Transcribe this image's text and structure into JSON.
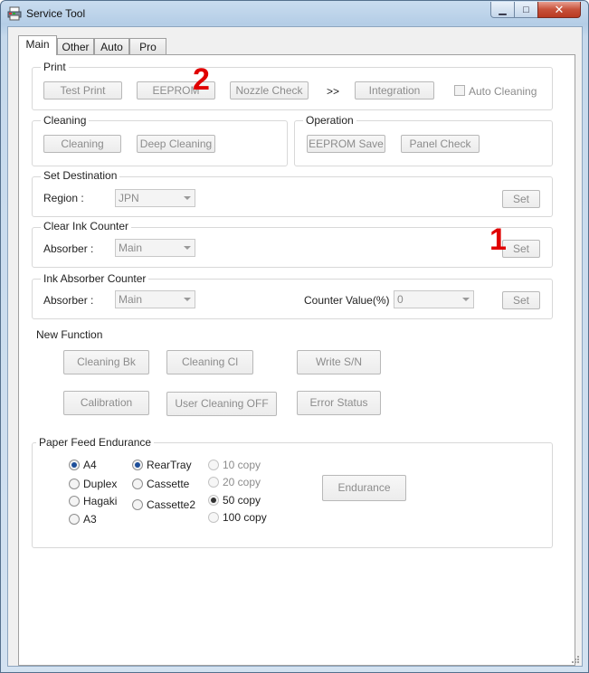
{
  "window": {
    "title": "Service Tool",
    "icon": "printer-app-icon"
  },
  "tabs": [
    {
      "label": "Main",
      "active": true
    },
    {
      "label": "Other",
      "active": false
    },
    {
      "label": "Auto",
      "active": false
    },
    {
      "label": "Pro",
      "active": false
    }
  ],
  "print": {
    "label": "Print",
    "test_print": "Test Print",
    "eeprom": "EEPROM",
    "nozzle_check": "Nozzle Check",
    "arrows": ">>",
    "integration": "Integration",
    "auto_cleaning": "Auto Cleaning"
  },
  "cleaning": {
    "label": "Cleaning",
    "cleaning": "Cleaning",
    "deep_cleaning": "Deep Cleaning"
  },
  "operation": {
    "label": "Operation",
    "eeprom_save": "EEPROM Save",
    "panel_check": "Panel Check"
  },
  "set_destination": {
    "label": "Set Destination",
    "region_label": "Region :",
    "region_value": "JPN",
    "set": "Set"
  },
  "clear_ink_counter": {
    "label": "Clear Ink Counter",
    "absorber_label": "Absorber :",
    "absorber_value": "Main",
    "set": "Set"
  },
  "ink_absorber_counter": {
    "label": "Ink Absorber Counter",
    "absorber_label": "Absorber :",
    "absorber_value": "Main",
    "counter_label": "Counter Value(%) :",
    "counter_value": "0",
    "set": "Set"
  },
  "new_function": {
    "label": "New Function",
    "cleaning_bk": "Cleaning Bk",
    "cleaning_cl": "Cleaning Cl",
    "write_sn": "Write S/N",
    "calibration": "Calibration",
    "user_cleaning_off": "User Cleaning OFF",
    "error_status": "Error Status"
  },
  "paper_feed": {
    "label": "Paper Feed Endurance",
    "sizes": [
      "A4",
      "Duplex",
      "Hagaki",
      "A3"
    ],
    "sources": [
      "RearTray",
      "Cassette",
      "Cassette2"
    ],
    "copies": [
      "10 copy",
      "20 copy",
      "50 copy",
      "100 copy"
    ],
    "selected_size": "A4",
    "selected_source": "RearTray",
    "selected_copies": "50 copy",
    "endurance": "Endurance"
  },
  "annotations": {
    "one": "1",
    "two": "2"
  },
  "colors": {
    "annotation": "#e00000",
    "radio_selected": "#1e4f9a"
  }
}
